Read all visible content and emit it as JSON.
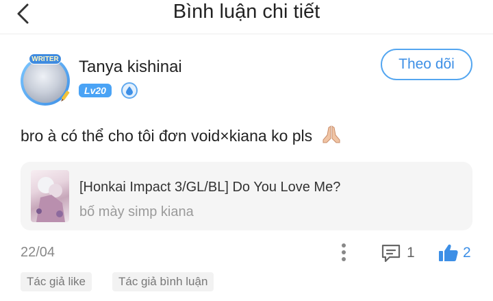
{
  "header": {
    "title": "Bình luận chi tiết"
  },
  "comment": {
    "username": "Tanya kishinai",
    "level": "Lv20",
    "writer_badge": "WRITER",
    "follow_label": "Theo dõi",
    "text": "bro à có thể cho tôi đơn void×kiana ko pls",
    "date": "22/04",
    "reply_count": "1",
    "like_count": "2"
  },
  "story": {
    "title": "[Honkai Impact 3/GL/BL] Do You Love Me?",
    "subtitle": "bố mày simp kiana"
  },
  "tags": {
    "author_like": "Tác giả like",
    "author_comment": "Tác giả bình luận"
  },
  "colors": {
    "accent": "#3d8fe6",
    "level_badge": "#4aa3f5",
    "card_bg": "#f5f5f5"
  }
}
